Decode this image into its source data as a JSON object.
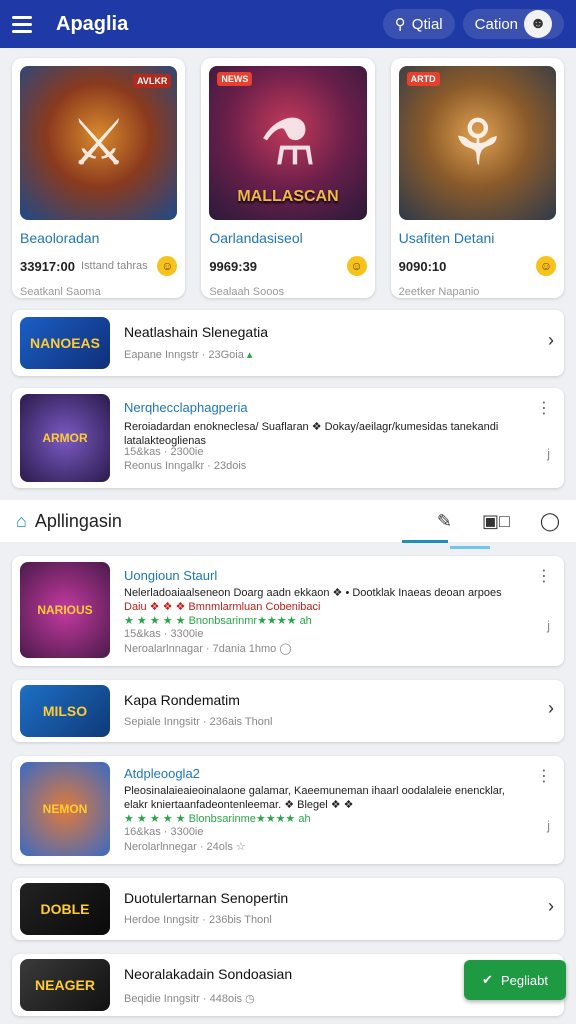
{
  "header": {
    "title": "Apaglia",
    "search_label": "Qtial",
    "account_label": "Cation"
  },
  "featured": [
    {
      "name": "Beaoloradan",
      "price": "33917:00",
      "extra": "Isttand tahras",
      "sub": "Seatkanl Saoma",
      "tag": "AVLKR"
    },
    {
      "name": "Oarlandasiseol",
      "price": "9969:39",
      "extra": "",
      "sub": "Sealaah Sooos",
      "tag": "NEWS",
      "art_text": "MALLASCAN"
    },
    {
      "name": "Usafiten Detani",
      "price": "9090:10",
      "extra": "",
      "sub": "2eetker Napanio",
      "tag": "ARTD"
    }
  ],
  "list_top": [
    {
      "title": "Neatlashain Slenegatia",
      "meta": "Eapane Inngstr · 23Goia",
      "thumb": "NANOEAS"
    },
    {
      "title": "Nerqhecclaphagperia",
      "desc1": "Reroiadardan enokneclesa/ Suaflaran ❖ Dokay/aeilagr/kumesidas tanekandi",
      "desc2": "latalakteoglienas",
      "meta1": "15&kas · 2300ie",
      "meta2": "Reonus Inngalkr · 23dois",
      "thumb": "ARMOR"
    }
  ],
  "section": {
    "title": "Apllingasin"
  },
  "list_bottom": [
    {
      "title": "Uongioun Staurl",
      "desc1": "Nelerladoaiaalseneon Doarg aadn ekkaon ❖ • Dootklak Inaeas deoan arpoes",
      "desc2": "Daiu ❖ ❖ ❖ Bmnmlarmluan Cobenibaci",
      "stars": "★ ★ ★ ★ ★ Bnonbsarinmr★★★★ ah",
      "meta1": "15&kas · 3300ie",
      "meta2": "Neroalarlnnagar · 7dania   1hmo",
      "thumb": "NARIOUS"
    },
    {
      "title": "Kapa Rondematim",
      "meta": "Sepiale Inngsitr · 236ais   Thonl",
      "thumb": "MILSO"
    },
    {
      "title": "Atdpleoogla2",
      "desc1": "Pleosinalaieaieoinalaone galamar, Kaeemuneman ihaarl oodalaleie enencklar,",
      "desc2": "elakr kniertaanfadeontenleemar. ❖ Blegel ❖ ❖",
      "stars": "★ ★ ★ ★ ★ Blonbsarinme★★★★ ah",
      "meta1": "16&kas · 3300ie",
      "meta2": "Nerolarlnnegar · 24ols",
      "thumb": "NEMON"
    },
    {
      "title": "Duotulertarnan Senopertin",
      "meta": "Herdoe Inngsitr · 236bis   Thonl",
      "thumb": "DOBLE"
    },
    {
      "title": "Neoralakadain Sondoasian",
      "meta": "Beqidie Inngsitr · 448ois",
      "thumb": "NEAGER"
    }
  ],
  "fab": {
    "label": "Pegliabt"
  },
  "colors": {
    "primary": "#1f3aa6",
    "accent": "#1f8fb8",
    "fab": "#1e9a42"
  }
}
